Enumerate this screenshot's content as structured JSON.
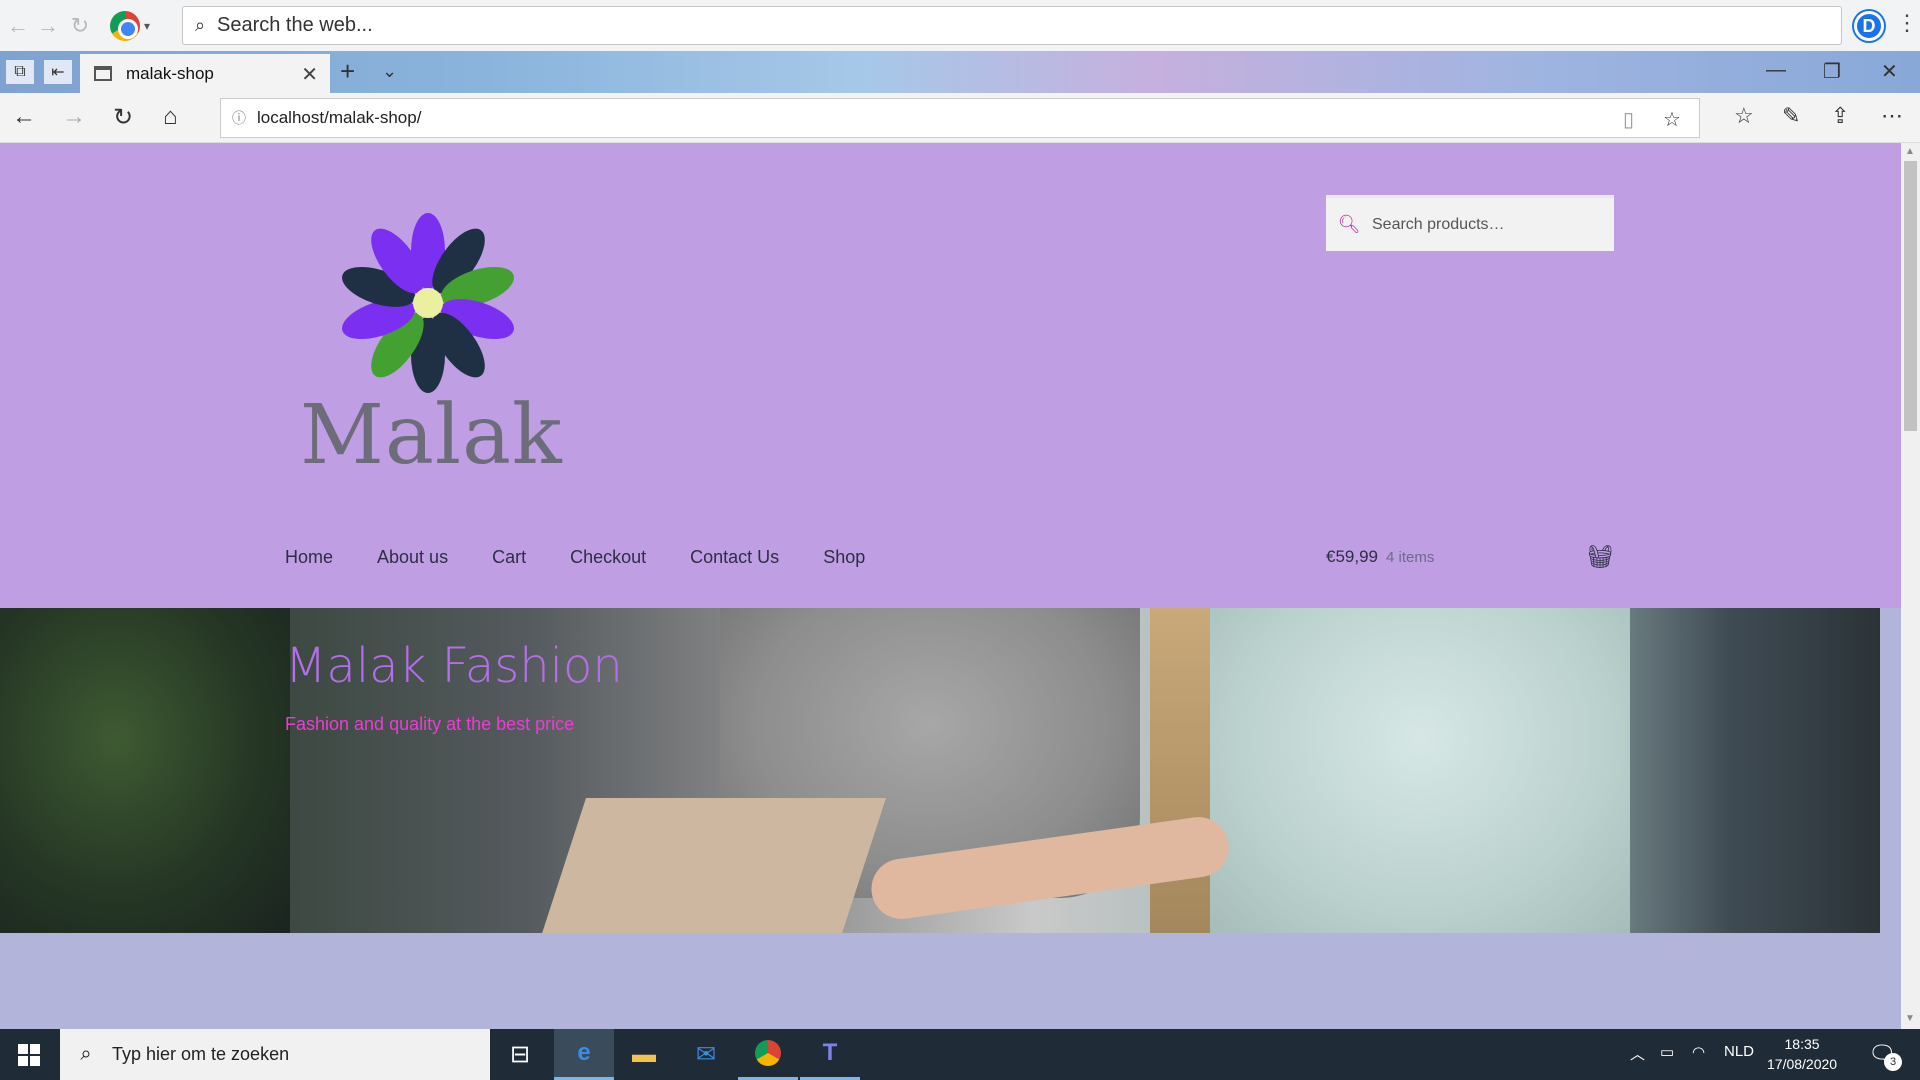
{
  "chrome": {
    "search_placeholder": "Search the web...",
    "profile_letter": "D",
    "menu_glyph": "⋮"
  },
  "tabs": [
    {
      "title": "malak-shop",
      "close": "✕"
    }
  ],
  "tabstrip": {
    "new_tab": "+",
    "dropdown": "⌄"
  },
  "window_controls": {
    "minimize": "—",
    "restore": "❐",
    "close": "✕"
  },
  "address": {
    "url": "localhost/malak-shop/",
    "info": "ⓘ"
  },
  "site": {
    "logo_text": "Malak",
    "search_placeholder": "Search products…",
    "nav": [
      "Home",
      "About us",
      "Cart",
      "Checkout",
      "Contact Us",
      "Shop"
    ],
    "cart": {
      "amount": "€59,99",
      "count": "4 items"
    },
    "hero": {
      "title": "Malak Fashion",
      "subtitle": "Fashion and quality at the best price"
    }
  },
  "taskbar": {
    "search_placeholder": "Typ hier om te zoeken",
    "language": "NLD",
    "time": "18:35",
    "date": "17/08/2020",
    "notifications": "3"
  },
  "colors": {
    "header_bg": "#bf9ee3",
    "page_bg": "#b3b4d9",
    "hero_title": "#b46fe8",
    "hero_subtitle": "#f03ad6",
    "search_icon": "#c51fa8",
    "taskbar": "#1f2c38"
  }
}
